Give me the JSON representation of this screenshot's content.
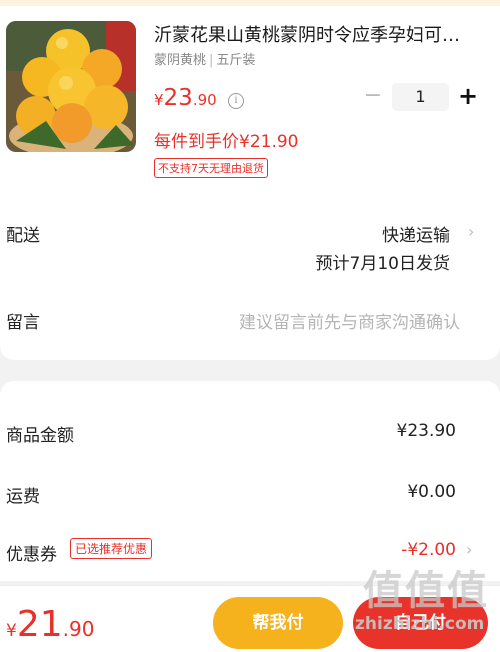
{
  "product": {
    "title": "沂蒙花果山黄桃蒙阴时令应季孕妇可…",
    "spec_variety": "蒙阴黄桃",
    "spec_separator": "|",
    "spec_weight": "五斤装",
    "price_currency": "¥",
    "price_int": "23",
    "price_dec": ".90",
    "info_glyph": "i",
    "quantity": "1",
    "minus_glyph": "−",
    "plus_glyph": "+",
    "hand_price": "每件到手价¥21.90",
    "return_badge": "不支持7天无理由退货"
  },
  "delivery": {
    "label": "配送",
    "method": "快递运输",
    "estimate": "预计7月10日发货",
    "chevron": "›"
  },
  "message": {
    "label": "留言",
    "placeholder": "建议留言前先与商家沟通确认"
  },
  "summary": {
    "goods_label": "商品金额",
    "goods_value": "¥23.90",
    "shipping_label": "运费",
    "shipping_value": "¥0.00",
    "coupon_label": "优惠券",
    "coupon_tag": "已选推荐优惠",
    "coupon_value": "-¥2.00",
    "chevron": "›"
  },
  "footer": {
    "total_currency": "¥",
    "total_int": "21",
    "total_dec": ".90",
    "help_pay_label": "帮我付",
    "self_pay_label": "自己付"
  },
  "watermark": {
    "glyphs": "值值值",
    "url": "zhizhizhi.com"
  },
  "colors": {
    "accent_red": "#e9302a",
    "help_button": "#f5b21c",
    "pay_button": "#e8332b"
  }
}
